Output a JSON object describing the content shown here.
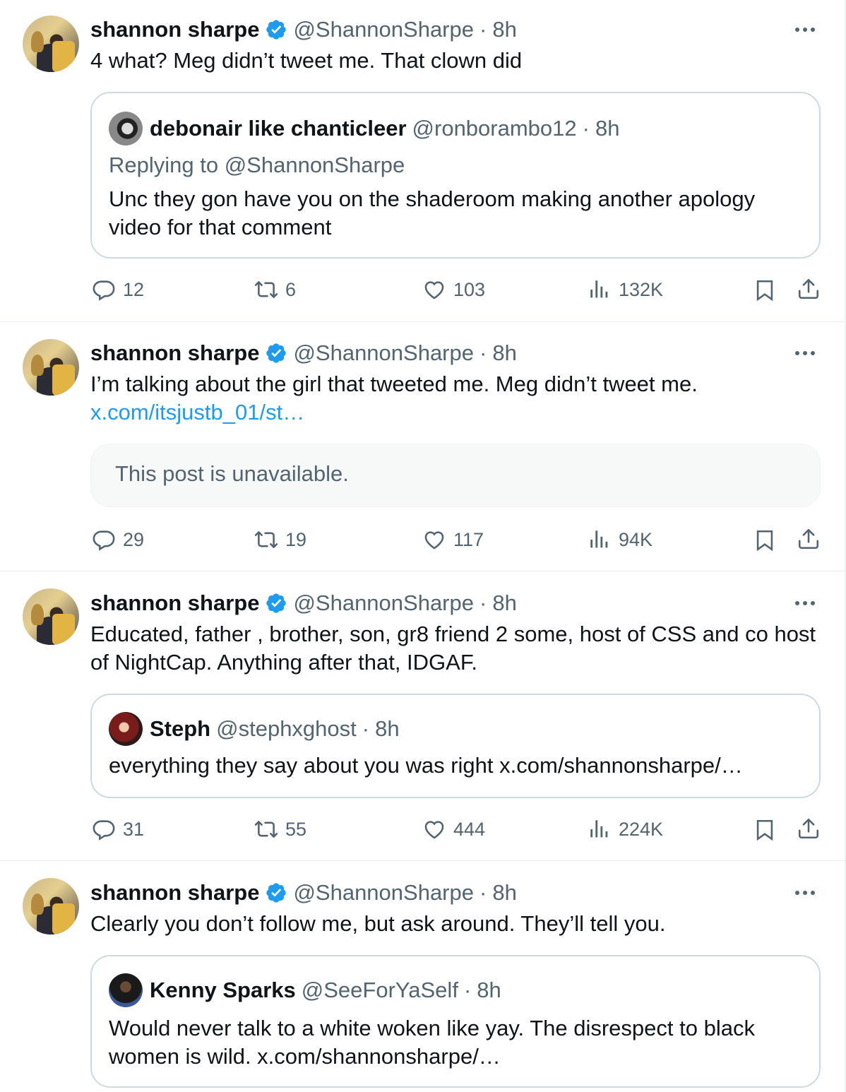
{
  "tweets": [
    {
      "author": {
        "name": "shannon sharpe",
        "handle": "@ShannonSharpe",
        "time": "8h"
      },
      "text": "4 what? Meg didn’t tweet me. That clown did",
      "quote": {
        "name": "debonair like chanticleer",
        "handle": "@ronborambo12",
        "time": "8h",
        "replying": "Replying to @ShannonSharpe",
        "text": "Unc they gon have you on the shaderoom making another apology video for that comment"
      },
      "stats": {
        "replies": "12",
        "reposts": "6",
        "likes": "103",
        "views": "132K"
      }
    },
    {
      "author": {
        "name": "shannon sharpe",
        "handle": "@ShannonSharpe",
        "time": "8h"
      },
      "text": "I’m talking about the girl that tweeted me. Meg didn’t tweet me.",
      "link": "x.com/itsjustb_01/st…",
      "unavailable": "This post is unavailable.",
      "stats": {
        "replies": "29",
        "reposts": "19",
        "likes": "117",
        "views": "94K"
      }
    },
    {
      "author": {
        "name": "shannon sharpe",
        "handle": "@ShannonSharpe",
        "time": "8h"
      },
      "text": "Educated, father , brother, son,  gr8 friend 2  some, host of CSS and co host of NightCap. Anything after that, IDGAF.",
      "quote": {
        "name": "Steph",
        "handle": "@stephxghost",
        "time": "8h",
        "text": "everything they say about you was right x.com/shannonsharpe/…"
      },
      "stats": {
        "replies": "31",
        "reposts": "55",
        "likes": "444",
        "views": "224K"
      }
    },
    {
      "author": {
        "name": "shannon sharpe",
        "handle": "@ShannonSharpe",
        "time": "8h"
      },
      "text": "Clearly you don’t follow me, but ask around. They’ll tell you.",
      "quote": {
        "name": "Kenny Sparks",
        "handle": "@SeeForYaSelf",
        "time": "8h",
        "text": "Would never talk to a white woken like yay. The disrespect to black women is wild. x.com/shannonsharpe/…"
      }
    }
  ],
  "separator": "·",
  "colors": {
    "accent": "#1d9bf0",
    "muted": "#536471",
    "text": "#0f1419",
    "border": "#cfd9de"
  },
  "icons": [
    "verified-badge-icon",
    "more-icon",
    "reply-icon",
    "repost-icon",
    "like-icon",
    "views-icon",
    "bookmark-icon",
    "share-icon"
  ]
}
